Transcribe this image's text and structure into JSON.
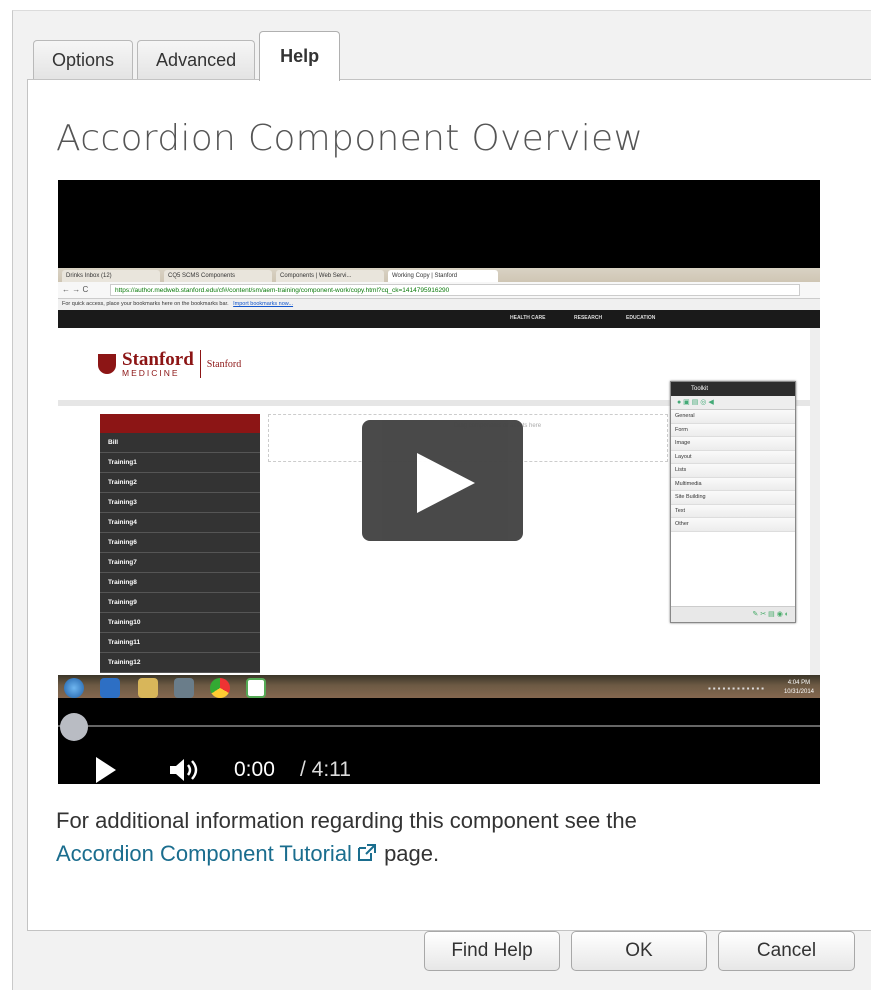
{
  "tabs": [
    {
      "label": "Options",
      "active": false
    },
    {
      "label": "Advanced",
      "active": false
    },
    {
      "label": "Help",
      "active": true
    }
  ],
  "panel": {
    "title": "Accordion Component Overview"
  },
  "video": {
    "current_time": "0:00",
    "duration": "/ 4:11",
    "progress": 0,
    "screenshot": {
      "browser_tabs": [
        "Drinks Inbox (12)",
        "CQ5 SCMS Components",
        "Components | Web Servi...",
        "Working Copy | Stanford"
      ],
      "url": "https://author.medweb.stanford.edu/cf#/content/sm/aem-training/component-work/copy.html?cq_ck=1414795916290",
      "bookmarks_text": "For quick access, place your bookmarks here on the bookmarks bar.",
      "bookmarks_link": "Import bookmarks now...",
      "top_nav": [
        "HEALTH CARE",
        "RESEARCH",
        "EDUCATION"
      ],
      "logo_name": "Stanford",
      "logo_sub": "MEDICINE",
      "logo_site": "Stanford",
      "nav_items": [
        "Bill",
        "Training1",
        "Training2",
        "Training3",
        "Training4",
        "Training6",
        "Training7",
        "Training8",
        "Training9",
        "Training10",
        "Training11",
        "Training12"
      ],
      "dropzone_text": "Drag components or assets here",
      "toolkit_title": "Toolkit",
      "toolkit_rows": [
        "General",
        "Form",
        "Image",
        "Layout",
        "Lists",
        "Multimedia",
        "Site Building",
        "Text",
        "Other"
      ],
      "clock_time": "4:04 PM",
      "clock_date": "10/31/2014"
    }
  },
  "info": {
    "text_before": "For additional information regarding this component see the",
    "link_text": "Accordion Component Tutorial",
    "text_after": "page."
  },
  "footer": {
    "find_help": "Find Help",
    "ok": "OK",
    "cancel": "Cancel"
  }
}
